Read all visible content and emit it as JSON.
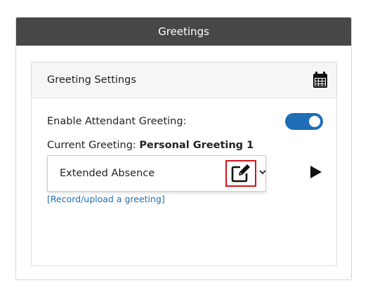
{
  "panel": {
    "title": "Greetings"
  },
  "card": {
    "title": "Greeting Settings",
    "header_icon": "calendar-icon"
  },
  "enable_greeting": {
    "label": "Enable Attendant Greeting:",
    "enabled": true,
    "toggle_color": "#1f6eb6"
  },
  "current_greeting": {
    "label": "Current Greeting:",
    "value": "Personal Greeting 1"
  },
  "dropdown": {
    "option_label": "Extended Absence",
    "edit_icon": "edit-icon",
    "chevron_icon": "chevron-down-icon",
    "highlight_color": "#d0141e"
  },
  "play_icon": "play-icon",
  "record_link": "[Record/upload a greeting]",
  "colors": {
    "titlebar": "#474747",
    "link": "#1f6eb6"
  }
}
